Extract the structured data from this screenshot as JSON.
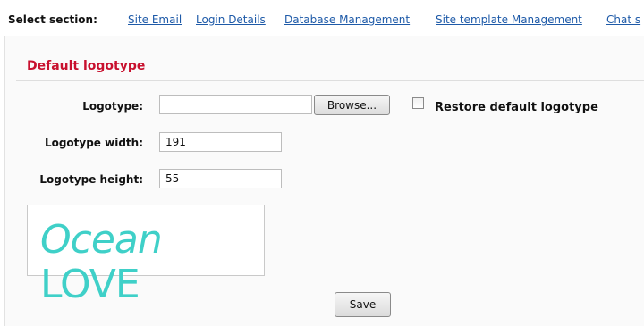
{
  "nav": {
    "label": "Select section:",
    "links": [
      "Site Email",
      "Login Details",
      "Database Management",
      "Site template Management",
      "Chat s"
    ]
  },
  "section": {
    "heading": "Default logotype"
  },
  "form": {
    "logotype_label": "Logotype:",
    "logotype_value": "",
    "browse_label": "Browse...",
    "restore_label": "Restore default logotype",
    "restore_checked": false,
    "width_label": "Logotype width:",
    "width_value": "191",
    "height_label": "Logotype height:",
    "height_value": "55",
    "save_label": "Save"
  },
  "logo": {
    "word1": "Ocean",
    "word2": "LOVE",
    "color": "#3fd0c8"
  }
}
